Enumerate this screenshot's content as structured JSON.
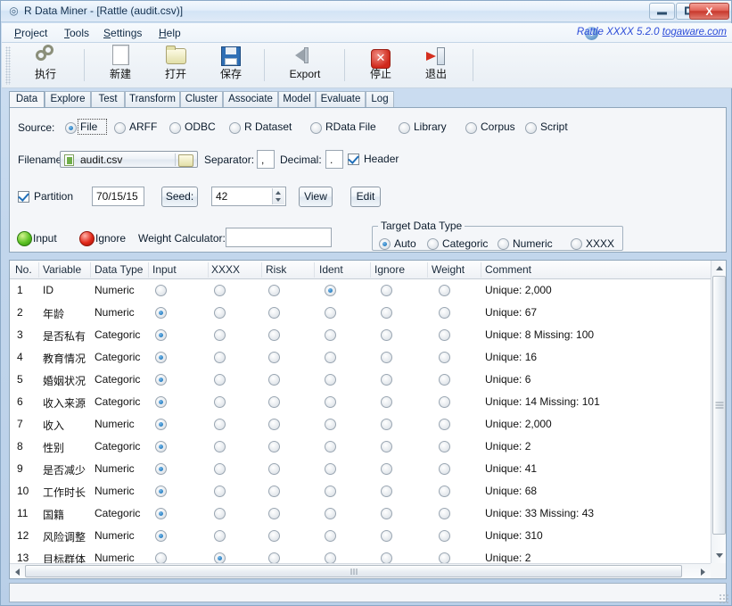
{
  "window": {
    "title": "R Data Miner - [Rattle (audit.csv)]",
    "icon": "rattle-app-icon",
    "buttons": {
      "minimize": "minimize",
      "maximize": "maximize",
      "close": "X"
    }
  },
  "menubar": {
    "items": [
      {
        "label": "Project",
        "accel": "P"
      },
      {
        "label": "Tools",
        "accel": "T"
      },
      {
        "label": "Settings",
        "accel": "S"
      },
      {
        "label": "Help",
        "accel": "H"
      }
    ],
    "brand": {
      "product": "Rattle XXXX 5.2.0",
      "site": "togaware.com",
      "icon": "info-icon"
    }
  },
  "toolbar": {
    "buttons": [
      {
        "label": "执行",
        "icon": "gear-execute-icon"
      },
      {
        "label": "新建",
        "icon": "new-page-icon"
      },
      {
        "label": "打开",
        "icon": "open-folder-icon"
      },
      {
        "label": "保存",
        "icon": "save-floppy-icon"
      },
      {
        "label": "Export",
        "icon": "export-icon"
      },
      {
        "label": "停止",
        "icon": "stop-icon"
      },
      {
        "label": "退出",
        "icon": "quit-icon"
      }
    ]
  },
  "tabs": {
    "active": "Data",
    "items": [
      "Data",
      "Explore",
      "Test",
      "Transform",
      "Cluster",
      "Associate",
      "Model",
      "Evaluate",
      "Log"
    ]
  },
  "data_tab": {
    "source": {
      "label": "Source:",
      "selected": "File",
      "options": [
        "File",
        "ARFF",
        "ODBC",
        "R Dataset",
        "RData File",
        "Library",
        "Corpus",
        "Script"
      ]
    },
    "filename": {
      "label": "Filename:",
      "value": "audit.csv",
      "file_icon": "csv-file-icon",
      "browse_icon": "folder-browse-icon"
    },
    "separator": {
      "label": "Separator:",
      "value": ","
    },
    "decimal": {
      "label": "Decimal:",
      "value": "."
    },
    "header": {
      "label": "Header",
      "checked": true
    },
    "partition": {
      "label": "Partition",
      "checked": true,
      "value": "70/15/15"
    },
    "seed": {
      "label": "Seed:",
      "value": "42"
    },
    "view_button": "View",
    "edit_button": "Edit",
    "legend": {
      "input": "Input",
      "ignore": "Ignore"
    },
    "weight_calculator": {
      "label": "Weight Calculator:",
      "value": ""
    },
    "target_data_type": {
      "legend": "Target Data Type",
      "selected": "Auto",
      "options": [
        "Auto",
        "Categoric",
        "Numeric",
        "XXXX"
      ]
    }
  },
  "variables_table": {
    "columns": [
      "No.",
      "Variable",
      "Data Type",
      "Input",
      "XXXX",
      "Risk",
      "Ident",
      "Ignore",
      "Weight",
      "Comment"
    ],
    "role_columns": [
      "Input",
      "XXXX",
      "Risk",
      "Ident",
      "Ignore",
      "Weight"
    ],
    "rows": [
      {
        "no": "1",
        "variable": "ID",
        "type": "Numeric",
        "role": "Ident",
        "comment": "Unique: 2,000"
      },
      {
        "no": "2",
        "variable": "年龄",
        "type": "Numeric",
        "role": "Input",
        "comment": "Unique: 67"
      },
      {
        "no": "3",
        "variable": "是否私有",
        "type": "Categoric",
        "role": "Input",
        "comment": "Unique: 8 Missing: 100"
      },
      {
        "no": "4",
        "variable": "教育情况",
        "type": "Categoric",
        "role": "Input",
        "comment": "Unique: 16"
      },
      {
        "no": "5",
        "variable": "婚姻状况",
        "type": "Categoric",
        "role": "Input",
        "comment": "Unique: 6"
      },
      {
        "no": "6",
        "variable": "收入来源",
        "type": "Categoric",
        "role": "Input",
        "comment": "Unique: 14 Missing: 101"
      },
      {
        "no": "7",
        "variable": "收入",
        "type": "Numeric",
        "role": "Input",
        "comment": "Unique: 2,000"
      },
      {
        "no": "8",
        "variable": "性别",
        "type": "Categoric",
        "role": "Input",
        "comment": "Unique: 2"
      },
      {
        "no": "9",
        "variable": "是否减少",
        "type": "Numeric",
        "role": "Input",
        "comment": "Unique: 41"
      },
      {
        "no": "10",
        "variable": "工作时长",
        "type": "Numeric",
        "role": "Input",
        "comment": "Unique: 68"
      },
      {
        "no": "11",
        "variable": "国籍",
        "type": "Categoric",
        "role": "Input",
        "comment": "Unique: 33 Missing: 43"
      },
      {
        "no": "12",
        "variable": "风险调整",
        "type": "Numeric",
        "role": "Input",
        "comment": "Unique: 310"
      },
      {
        "no": "13",
        "variable": "目标群体",
        "type": "Numeric",
        "role": "XXXX",
        "comment": "Unique: 2"
      }
    ]
  },
  "colors": {
    "accent": "#2b4bd8",
    "input_ball": "#5cc224",
    "ignore_ball": "#e1281a",
    "radio_selected": "#0b6bb5",
    "close_button": "#c8382c"
  }
}
